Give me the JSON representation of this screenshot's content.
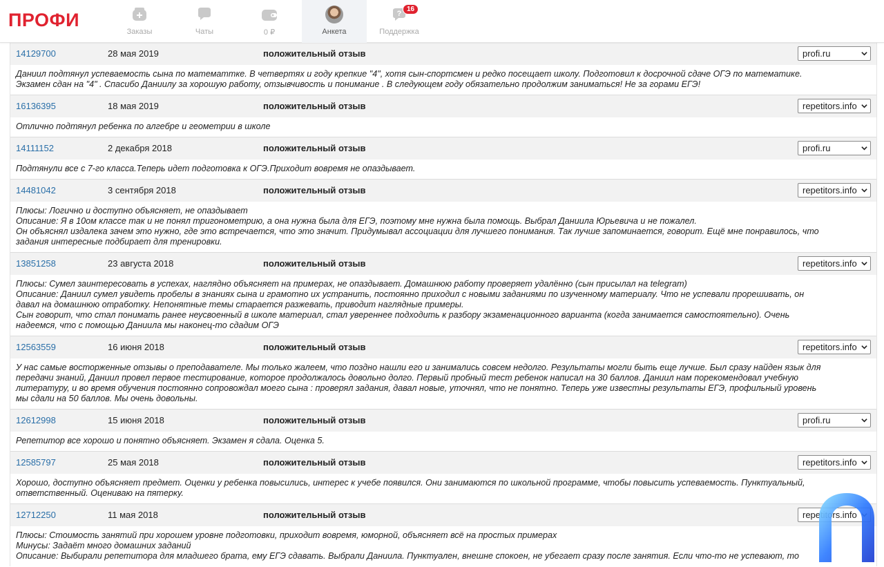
{
  "brand": {
    "logo": "ПРОФИ",
    "accent": "#e0222f",
    "link_color": "#2a6fa8"
  },
  "nav": [
    {
      "label": "Заказы",
      "icon": "orders-icon"
    },
    {
      "label": "Чаты",
      "icon": "chats-icon"
    },
    {
      "label": "0 ₽",
      "icon": "wallet-icon"
    },
    {
      "label": "Анкета",
      "icon": "profile-avatar",
      "active": true
    },
    {
      "label": "Поддержка",
      "icon": "support-icon",
      "badge": "16"
    }
  ],
  "reviews": [
    {
      "id": "14129700",
      "date": "28 мая 2019",
      "type": "положительный отзыв",
      "source": "profi.ru",
      "lines": [
        "Даниил подтянул успеваемость сына по математтке. В четвертях и году крепкие \"4\", хотя сын-спортсмен и редко посещает школу. Подготовил к досрочной сдаче ОГЭ по математике.",
        "Экзамен сдан на \"4\" . Спасибо Даниилу за хорошую работу, отзывчивость и понимание . В следующем году обязательно продолжим заниматься! Не за горами ЕГЭ!"
      ]
    },
    {
      "id": "16136395",
      "date": "18 мая 2019",
      "type": "положительный отзыв",
      "source": "repetitors.info",
      "lines": [
        "Отлично подтянул ребенка по алгебре и геометрии в школе"
      ]
    },
    {
      "id": "14111152",
      "date": "2 декабря 2018",
      "type": "положительный отзыв",
      "source": "profi.ru",
      "lines": [
        "Подтянули все с 7-го класса.Теперь идет подготовка к ОГЭ.Приходит вовремя не опаздывает."
      ]
    },
    {
      "id": "14481042",
      "date": "3 сентября 2018",
      "type": "положительный отзыв",
      "source": "repetitors.info",
      "lines": [
        "Плюсы: Логично и доступно объясняет, не опаздывает",
        "Описание: Я в 10ом классе так и не понял тригонометрию, а она нужна была для ЕГЭ, поэтому мне нужна была помощь. Выбрал Даниила Юрьевича и не пожалел.",
        "Он объяснял издалека зачем это нужно, где это встречается, что это значит. Придумывал ассоциации для лучшего понимания. Так лучше запоминается, говорит. Ещё мне понравилось, что",
        "задания интересные подбирает для тренировки."
      ]
    },
    {
      "id": "13851258",
      "date": "23 августа 2018",
      "type": "положительный отзыв",
      "source": "repetitors.info",
      "lines": [
        "Плюсы: Сумел заинтересовать в успехах, наглядно объясняет на примерах, не опаздывает. Домашнюю работу проверяет удалённо (сын присылал на telegram)",
        "Описание: Даниил сумел увидеть пробелы в знаниях сына и грамотно их устранить, постоянно приходил с новыми заданиями по изученному материалу. Что не успевали прорешивать, он",
        "давал на домашнюю отработку. Непонятные темы старается разжевать, приводит наглядные примеры.",
        "Сын говорит, что стал понимать ранее неусвоенный в школе материал, стал увереннее подходить к разбору экзаменационного варианта (когда занимается самостоятельно). Очень",
        "надеемся, что с помощью Даниила мы наконец-то сдадим ОГЭ"
      ]
    },
    {
      "id": "12563559",
      "date": "16 июня 2018",
      "type": "положительный отзыв",
      "source": "repetitors.info",
      "lines": [
        "У нас самые восторженные отзывы о преподавателе. Мы только жалеем, что поздно нашли его и занимались совсем недолго. Результаты могли быть еще лучше. Был сразу найден язык для",
        "передачи знаний, Даниил провел первое тестирование, которое продолжалось довольно долго. Первый пробный тест ребенок написал на 30 баллов. Даниил нам порекомендовал учебную",
        "литературу, и во время обучения постоянно сопровождал моего сына : проверял задания, давал новые, уточнял, что не понятно. Теперь уже известны результаты ЕГЭ, профильный уровень",
        "мы сдали на 50 баллов. Мы очень довольны."
      ]
    },
    {
      "id": "12612998",
      "date": "15 июня 2018",
      "type": "положительный отзыв",
      "source": "profi.ru",
      "lines": [
        "Репетитор все хорошо и понятно объясняет. Экзамен я сдала. Оценка 5."
      ]
    },
    {
      "id": "12585797",
      "date": "25 мая 2018",
      "type": "положительный отзыв",
      "source": "repetitors.info",
      "lines": [
        "Хорошо, доступно объясняет предмет. Оценки у ребенка повысились, интерес к учебе появился. Они занимаются по школьной программе, чтобы повысить успеваемость. Пунктуальный,",
        "ответственный. Оцениваю на пятерку."
      ]
    },
    {
      "id": "12712250",
      "date": "11 мая 2018",
      "type": "положительный отзыв",
      "source": "repetitors.info",
      "lines": [
        "Плюсы: Стоимость занятий при хорошем уровне подготовки, приходит вовремя, юморной, объясняет всё на простых примерах",
        "Минусы: Задаёт много домашних заданий",
        "Описание: Выбирали репетитора для младшего брата, ему ЕГЭ сдавать. Выбрали Даниила. Пунктуален, внешне спокоен, не убегает сразу после занятия. Если что-то не успевают, то"
      ]
    }
  ]
}
